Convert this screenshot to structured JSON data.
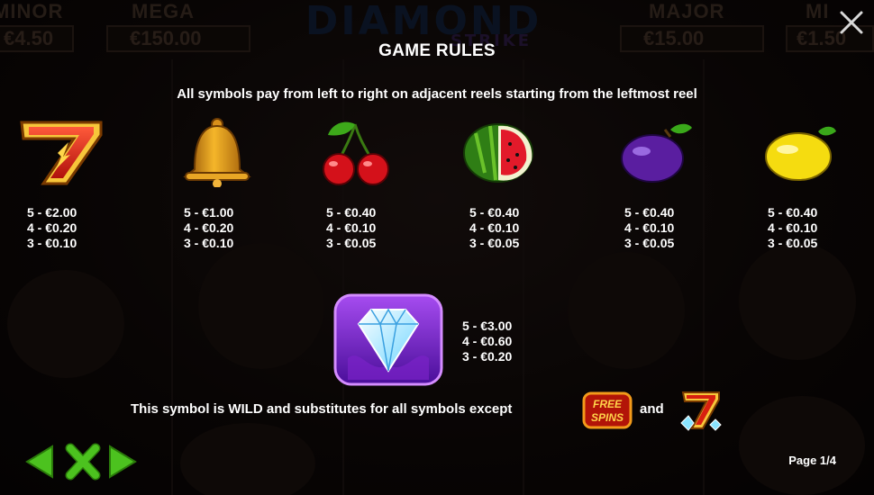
{
  "background": {
    "jackpots": [
      {
        "label": "MINOR",
        "value": "€4.50"
      },
      {
        "label": "MEGA",
        "value": "€150.00"
      },
      {
        "label": "MAJOR",
        "value": "€15.00"
      },
      {
        "label": "MI",
        "value": "€1.50"
      }
    ],
    "logo": "DIAMOND",
    "logo_sub": "STRIKE"
  },
  "header": {
    "title": "GAME RULES",
    "subtitle": "All symbols pay from left to right on adjacent reels starting from the leftmost reel"
  },
  "symbols": [
    {
      "icon": "seven-icon",
      "pays": [
        "5 - €2.00",
        "4 - €0.20",
        "3 - €0.10"
      ]
    },
    {
      "icon": "bell-icon",
      "pays": [
        "5 - €1.00",
        "4 - €0.20",
        "3 - €0.10"
      ]
    },
    {
      "icon": "cherry-icon",
      "pays": [
        "5 - €0.40",
        "4 - €0.10",
        "3 - €0.05"
      ]
    },
    {
      "icon": "watermelon-icon",
      "pays": [
        "5 - €0.40",
        "4 - €0.10",
        "3 - €0.05"
      ]
    },
    {
      "icon": "plum-icon",
      "pays": [
        "5 - €0.40",
        "4 - €0.10",
        "3 - €0.05"
      ]
    },
    {
      "icon": "lemon-icon",
      "pays": [
        "5 - €0.40",
        "4 - €0.10",
        "3 - €0.05"
      ]
    }
  ],
  "wild": {
    "icon": "diamond-wild-icon",
    "pays": [
      "5 - €3.00",
      "4 - €0.60",
      "3 - €0.20"
    ],
    "description": "This symbol is WILD and substitutes for all symbols except",
    "and": "and",
    "free_spins_label": [
      "FREE",
      "SPINS"
    ]
  },
  "footer": {
    "page": "Page 1/4"
  },
  "colors": {
    "nav_green": "#4cc21f",
    "text": "#ffffff",
    "wild_purple": "#7a2bd6"
  }
}
